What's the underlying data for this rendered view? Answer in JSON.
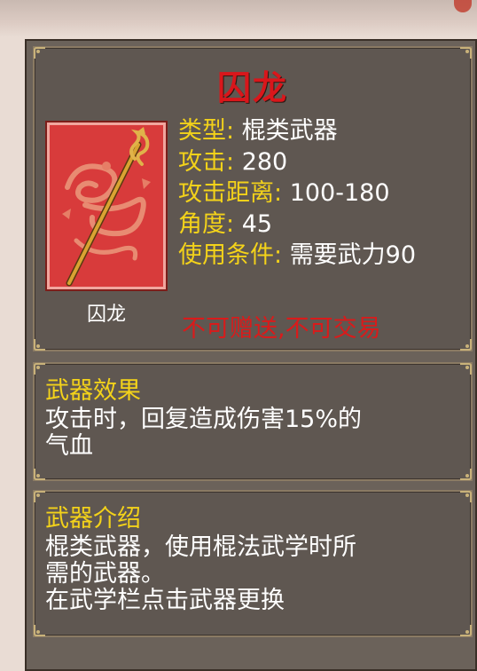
{
  "item": {
    "name": "囚龙",
    "card_label": "囚龙",
    "stats": [
      {
        "key": "类型",
        "value": "棍类武器"
      },
      {
        "key": "攻击",
        "value": "280"
      },
      {
        "key": "攻击距离",
        "value": "100-180"
      },
      {
        "key": "角度",
        "value": "45"
      },
      {
        "key": "使用条件",
        "value": "需要武力90"
      }
    ],
    "trade_notice": "不可赠送,不可交易"
  },
  "effect": {
    "heading": "武器效果",
    "lines": [
      "攻击时，回复造成伤害15%的",
      "气血"
    ]
  },
  "intro": {
    "heading": "武器介绍",
    "lines": [
      "棍类武器，使用棍法武学时所",
      "需的武器。",
      "在武学栏点击武器更换"
    ]
  },
  "colors": {
    "title_red": "#d9161b",
    "label_yellow": "#f3d21a",
    "notice_red": "#d91b1b",
    "card_red": "#d83b3b"
  },
  "icons": [
    "dragon-emblem-icon",
    "golden-staff-icon",
    "corner-ornament-icon"
  ]
}
